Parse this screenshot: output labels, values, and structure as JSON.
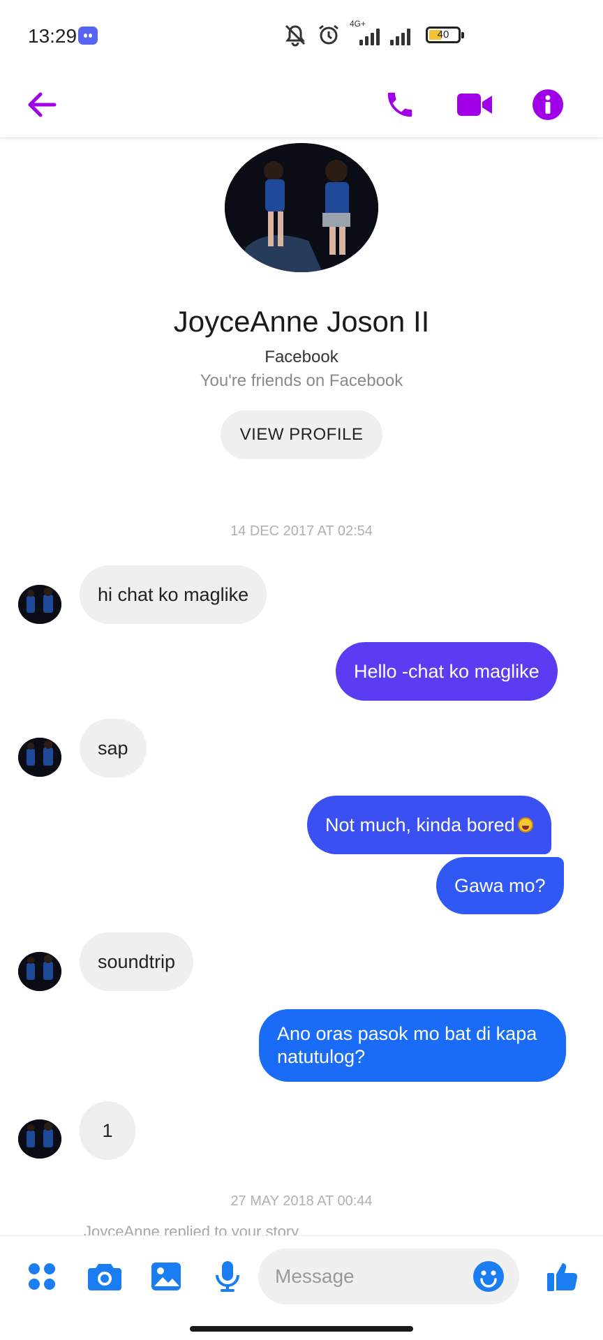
{
  "status_bar": {
    "time": "13:29",
    "network_type": "4G+",
    "battery": "40",
    "battery_level": 0.4
  },
  "colors": {
    "accent": "#8a2be2",
    "nav_icon": "#a000e8",
    "bubble_violet": "#5b3cf2",
    "bubble_indigo": "#3b50f2",
    "bubble_blue": "#1a6bf5",
    "received_bubble": "#efefef",
    "composer_icon": "#1a7ef2"
  },
  "icons": {
    "back": "arrow-left-icon",
    "call": "phone-icon",
    "video": "video-camera-icon",
    "info": "info-icon",
    "apps": "four-dots-icon",
    "camera": "camera-icon",
    "gallery": "image-icon",
    "voice": "microphone-icon",
    "emoji": "smiley-icon",
    "like": "thumbs-up-icon"
  },
  "profile": {
    "name": "JoyceAnne Joson II",
    "network": "Facebook",
    "friendship": "You're friends on Facebook",
    "view_profile_label": "VIEW PROFILE"
  },
  "timestamps": [
    "14 DEC 2017 AT 02:54",
    "27 MAY 2018 AT 00:44"
  ],
  "messages": [
    {
      "from": "them",
      "text": "hi chat ko maglike"
    },
    {
      "from": "me",
      "text": "Hello -chat ko maglike"
    },
    {
      "from": "them",
      "text": "sap"
    },
    {
      "from": "me",
      "text": "Not much, kinda bored",
      "emoji": "grinning-face-with-tongue"
    },
    {
      "from": "me",
      "text": "Gawa mo?"
    },
    {
      "from": "them",
      "text": "soundtrip"
    },
    {
      "from": "me",
      "text": "Ano oras pasok mo bat di kapa natutulog?"
    },
    {
      "from": "them",
      "text": "1"
    }
  ],
  "story_note": "JoyceAnne replied to your story",
  "composer": {
    "placeholder": "Message"
  }
}
